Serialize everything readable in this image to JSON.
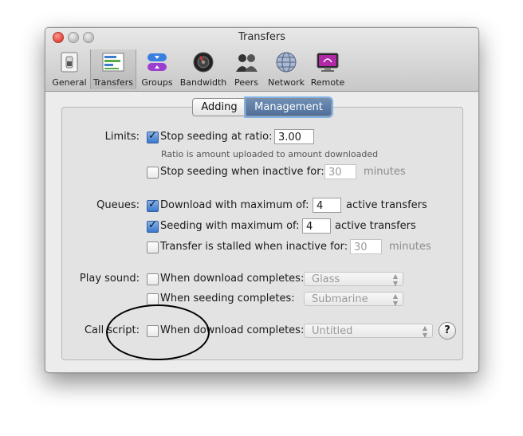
{
  "window": {
    "title": "Transfers"
  },
  "toolbar": {
    "items": [
      {
        "label": "General",
        "icon": "switch-icon"
      },
      {
        "label": "Transfers",
        "icon": "transfers-icon"
      },
      {
        "label": "Groups",
        "icon": "groups-icon"
      },
      {
        "label": "Bandwidth",
        "icon": "bandwidth-icon"
      },
      {
        "label": "Peers",
        "icon": "peers-icon"
      },
      {
        "label": "Network",
        "icon": "network-globe-icon"
      },
      {
        "label": "Remote",
        "icon": "remote-monitor-icon"
      }
    ],
    "selected": "Transfers"
  },
  "tabs": {
    "adding": "Adding",
    "management": "Management",
    "selected": "Management"
  },
  "limits": {
    "label": "Limits:",
    "ratio": {
      "checked": true,
      "label": "Stop seeding at ratio:",
      "value": "3.00",
      "note": "Ratio is amount uploaded to amount downloaded"
    },
    "inactive": {
      "checked": false,
      "label": "Stop seeding when inactive for:",
      "value": "30",
      "unit": "minutes"
    }
  },
  "queues": {
    "label": "Queues:",
    "download": {
      "checked": true,
      "label": "Download with maximum of:",
      "value": "4",
      "unit": "active transfers"
    },
    "seeding": {
      "checked": true,
      "label": "Seeding with maximum of:",
      "value": "4",
      "unit": "active transfers"
    },
    "stalled": {
      "checked": false,
      "label": "Transfer is stalled when inactive for:",
      "value": "30",
      "unit": "minutes"
    }
  },
  "sound": {
    "label": "Play sound:",
    "download": {
      "checked": false,
      "label": "When download completes:",
      "selected": "Glass"
    },
    "seeding": {
      "checked": false,
      "label": "When seeding completes:",
      "selected": "Submarine"
    }
  },
  "script": {
    "label": "Call script:",
    "download": {
      "checked": false,
      "label": "When download completes:",
      "selected": "Untitled"
    },
    "help": "?"
  },
  "colors": {
    "accent": "#4f6f99",
    "checkbox": "#3b78cc",
    "close": "#e0443a"
  }
}
